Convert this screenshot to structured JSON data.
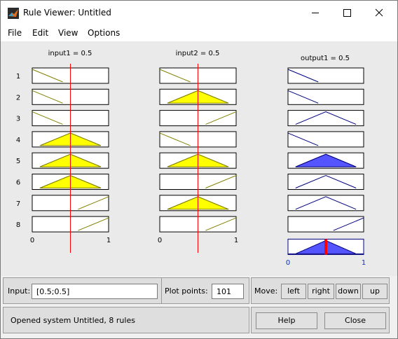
{
  "window": {
    "title": "Rule Viewer: Untitled"
  },
  "menu": [
    "File",
    "Edit",
    "View",
    "Options"
  ],
  "inputs": [
    {
      "label": "input1 = 0.5",
      "value": 0.5,
      "range": [
        0,
        1
      ],
      "tick_min": "0",
      "tick_max": "1"
    },
    {
      "label": "input2 = 0.5",
      "value": 0.5,
      "range": [
        0,
        1
      ],
      "tick_min": "0",
      "tick_max": "1"
    }
  ],
  "output": {
    "label": "output1 = 0.5",
    "value": 0.5,
    "range": [
      0,
      1
    ],
    "tick_min": "0",
    "tick_max": "1"
  },
  "rules": [
    {
      "number": "1",
      "input1": "low",
      "input1_fire": 0,
      "input2": "low",
      "input2_fire": 0,
      "output": "low"
    },
    {
      "number": "2",
      "input1": "low",
      "input1_fire": 0,
      "input2": "mid",
      "input2_fire": 1.0,
      "output": "low"
    },
    {
      "number": "3",
      "input1": "low",
      "input1_fire": 0,
      "input2": "high",
      "input2_fire": 0,
      "output": "mid"
    },
    {
      "number": "4",
      "input1": "mid",
      "input1_fire": 1.0,
      "input2": "low",
      "input2_fire": 0,
      "output": "low"
    },
    {
      "number": "5",
      "input1": "mid",
      "input1_fire": 1.0,
      "input2": "mid",
      "input2_fire": 1.0,
      "output": "mid",
      "output_fire": 1.0
    },
    {
      "number": "6",
      "input1": "mid",
      "input1_fire": 1.0,
      "input2": "high",
      "input2_fire": 0,
      "output": "mid"
    },
    {
      "number": "7",
      "input1": "high",
      "input1_fire": 0,
      "input2": "mid",
      "input2_fire": 1.0,
      "output": "mid"
    },
    {
      "number": "8",
      "input1": "high",
      "input1_fire": 0,
      "input2": "high",
      "input2_fire": 0,
      "output": "high"
    }
  ],
  "controls": {
    "input_label": "Input:",
    "input_value": "[0.5;0.5]",
    "plot_points_label": "Plot points:",
    "plot_points_value": "101",
    "move_label": "Move:",
    "move_left": "left",
    "move_right": "right",
    "move_down": "down",
    "move_up": "up",
    "help": "Help",
    "close": "Close"
  },
  "status": "Opened system Untitled, 8 rules",
  "colors": {
    "input_fill": "#ffff00",
    "input_line": "#808000",
    "output_fill": "#5555ff",
    "output_line": "#000080",
    "index_line": "#ff0000",
    "tick_output": "#0033cc"
  }
}
